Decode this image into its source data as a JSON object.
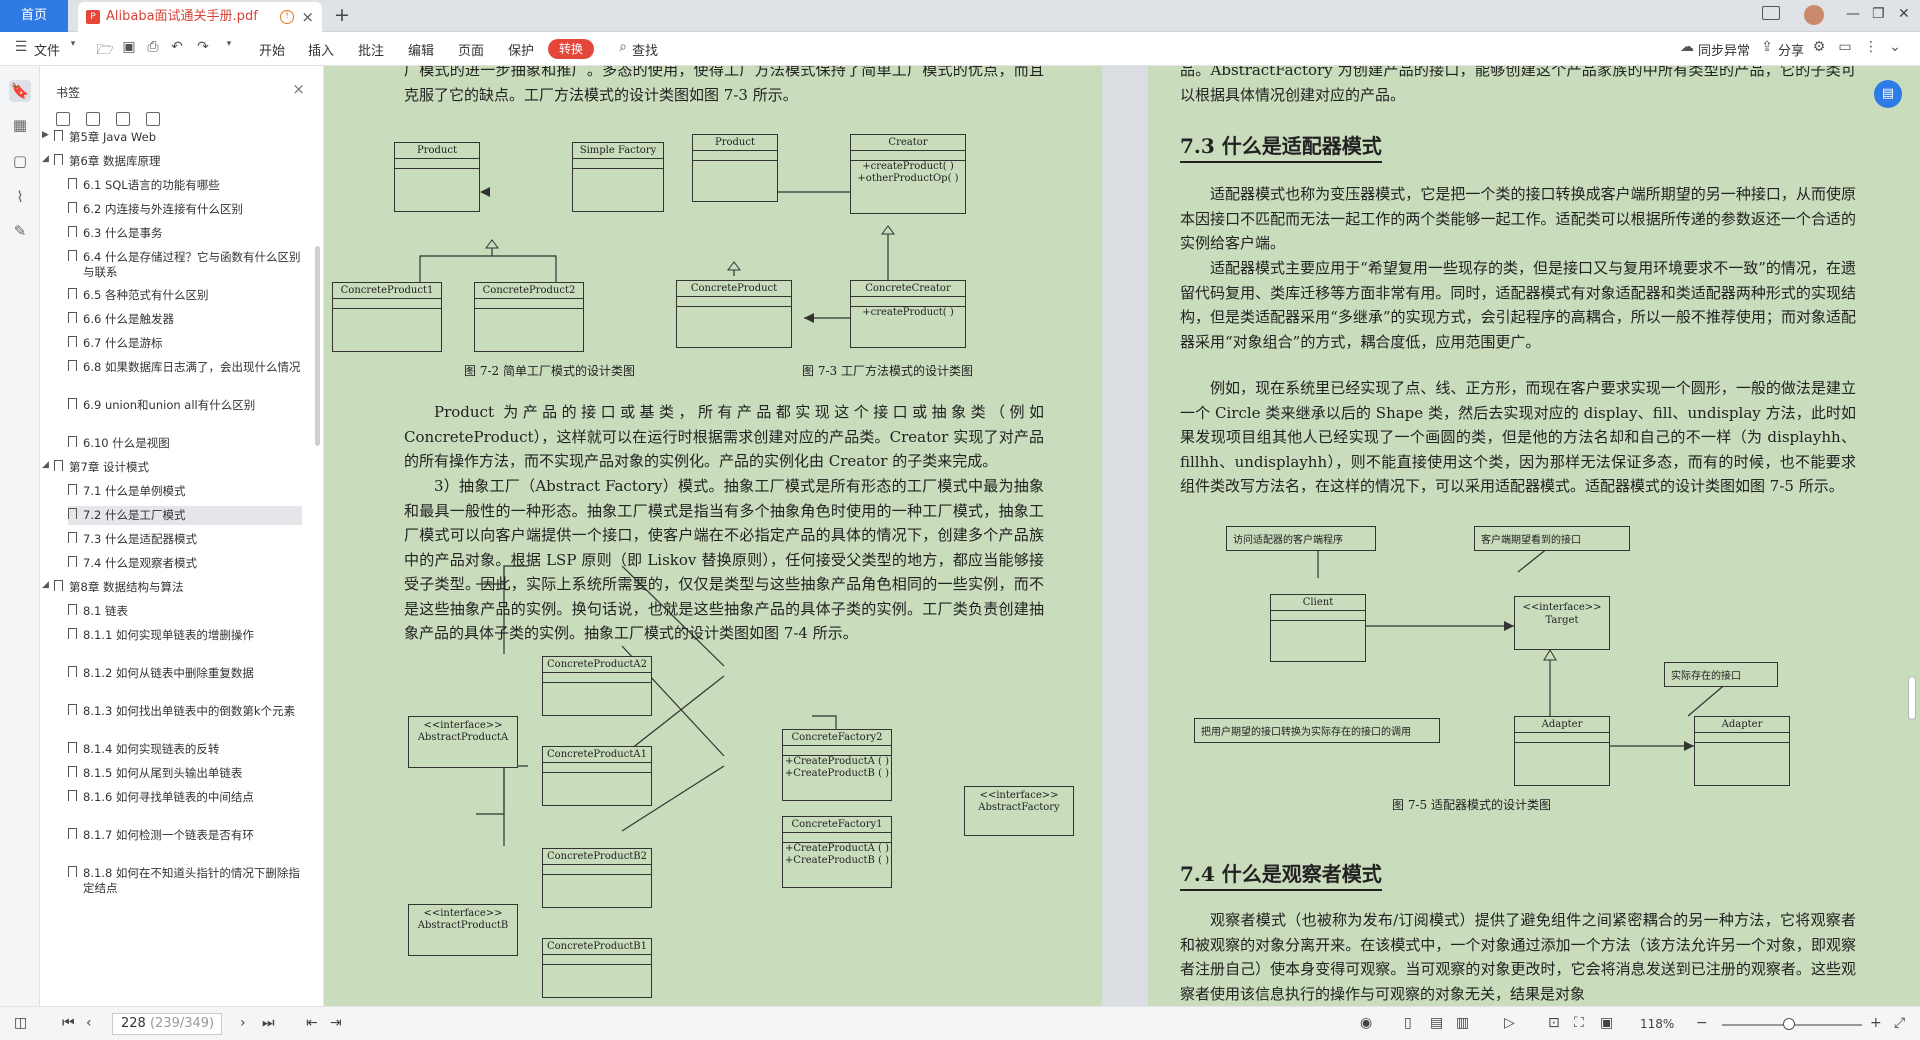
{
  "tabs": {
    "home": "首页",
    "doc_title": "Alibaba面试通关手册.pdf",
    "pdf_badge": "P",
    "warn": "!",
    "close": "×",
    "add": "+"
  },
  "window": {
    "min": "—",
    "restore": "❐",
    "close": "✕"
  },
  "toolbar": {
    "file": "文件",
    "start": "开始",
    "insert": "插入",
    "annotate": "批注",
    "edit": "编辑",
    "page": "页面",
    "protect": "保护",
    "convert": "转换",
    "find": "查找",
    "sync": "同步异常",
    "share": "分享"
  },
  "sidebar": {
    "title": "书签",
    "items": [
      {
        "label": "第5章 Java Web",
        "level": 0,
        "arrow": "▶"
      },
      {
        "label": "第6章 数据库原理",
        "level": 0,
        "arrow": "◢"
      },
      {
        "label": "6.1  SQL语言的功能有哪些",
        "level": 1
      },
      {
        "label": "6.2  内连接与外连接有什么区别",
        "level": 1
      },
      {
        "label": "6.3  什么是事务",
        "level": 1
      },
      {
        "label": "6.4  什么是存储过程？它与函数有什么区别与联系",
        "level": 1
      },
      {
        "label": "6.5  各种范式有什么区别",
        "level": 1
      },
      {
        "label": "6.6  什么是触发器",
        "level": 1
      },
      {
        "label": "6.7  什么是游标",
        "level": 1
      },
      {
        "label": "6.8  如果数据库日志满了，会出现什么情况",
        "level": 1
      },
      {
        "label": "6.9  union和union all有什么区别",
        "level": 1
      },
      {
        "label": "6.10  什么是视图",
        "level": 1
      },
      {
        "label": "第7章 设计模式",
        "level": 0,
        "arrow": "◢"
      },
      {
        "label": "7.1  什么是单例模式",
        "level": 1
      },
      {
        "label": "7.2  什么是工厂模式",
        "level": 1,
        "selected": true
      },
      {
        "label": "7.3  什么是适配器模式",
        "level": 1
      },
      {
        "label": "7.4  什么是观察者模式",
        "level": 1
      },
      {
        "label": "第8章 数据结构与算法",
        "level": 0,
        "arrow": "◢"
      },
      {
        "label": "8.1  链表",
        "level": 1
      },
      {
        "label": "8.1.1  如何实现单链表的增删操作",
        "level": 1
      },
      {
        "label": "8.1.2  如何从链表中删除重复数据",
        "level": 1
      },
      {
        "label": "8.1.3  如何找出单链表中的倒数第k个元素",
        "level": 1
      },
      {
        "label": "8.1.4  如何实现链表的反转",
        "level": 1
      },
      {
        "label": "8.1.5  如何从尾到头输出单链表",
        "level": 1
      },
      {
        "label": "8.1.6  如何寻找单链表的中间结点",
        "level": 1
      },
      {
        "label": "8.1.7  如何检测一个链表是否有环",
        "level": 1
      },
      {
        "label": "8.1.8  如何在不知道头指针的情况下删除指定结点",
        "level": 1
      }
    ]
  },
  "left_page": {
    "p1": "厂模式的进一步抽象和推广。多态的使用，使得工厂方法模式保持了简单工厂模式的优点，而且克服了它的缺点。工厂方法模式的设计类图如图 7-3 所示。",
    "cap72": "图 7-2   简单工厂模式的设计类图",
    "cap73": "图 7-3   工厂方法模式的设计类图",
    "p2": "Product 为产品的接口或基类，所有产品都实现这个接口或抽象类（例如 ConcreteProduct），这样就可以在运行时根据需求创建对应的产品类。Creator 实现了对产品的所有操作方法，而不实现产品对象的实例化。产品的实例化由 Creator 的子类来完成。",
    "p3": "3）抽象工厂（Abstract Factory）模式。抽象工厂模式是所有形态的工厂模式中最为抽象和最具一般性的一种形态。抽象工厂模式是指当有多个抽象角色时使用的一种工厂模式，抽象工厂模式可以向客户端提供一个接口，使客户端在不必指定产品的具体的情况下，创建多个产品族中的产品对象。根据 LSP 原则（即 Liskov 替换原则），任何接受父类型的地方，都应当能够接受子类型。因此，实际上系统所需要的，仅仅是类型与这些抽象产品角色相同的一些实例，而不是这些抽象产品的实例。换句话说，也就是这些抽象产品的具体子类的实例。工厂类负责创建抽象产品的具体子类的实例。抽象工厂模式的设计类图如图 7-4 所示。",
    "uml": {
      "product": "Product",
      "simple_factory": "Simple Factory",
      "cp1": "ConcreteProduct1",
      "cp2": "ConcreteProduct2",
      "product2": "Product",
      "creator": "Creator",
      "creator_ops": "+createProduct( )\n+otherProductOp( )",
      "concrete_product": "ConcreteProduct",
      "concrete_creator": "ConcreteCreator",
      "cc_ops": "+createProduct( )",
      "cpa2": "ConcreteProductA2",
      "apa": "<<interface>>\nAbstractProductA",
      "cpa1": "ConcreteProductA1",
      "cf2": "ConcreteFactory2",
      "cf_ops": "+CreateProductA ( )\n+CreateProductB ( )",
      "af": "<<interface>>\nAbstractFactory",
      "cf1": "ConcreteFactory1",
      "cpb2": "ConcreteProductB2",
      "apb": "<<interface>>\nAbstractProductB",
      "cpb1": "ConcreteProductB1"
    }
  },
  "right_page": {
    "p0": "品。AbstractFactory 为创建产品的接口，能够创建这个产品家族的中所有类型的产品，它的子类可以根据具体情况创建对应的产品。",
    "h73": "7.3   什么是适配器模式",
    "p1": "适配器模式也称为变压器模式，它是把一个类的接口转换成客户端所期望的另一种接口，从而使原本因接口不匹配而无法一起工作的两个类能够一起工作。适配类可以根据所传递的参数返还一个合适的实例给客户端。",
    "p2": "适配器模式主要应用于“希望复用一些现存的类，但是接口又与复用环境要求不一致”的情况，在遗留代码复用、类库迁移等方面非常有用。同时，适配器模式有对象适配器和类适配器两种形式的实现结构，但是类适配器采用“多继承”的实现方式，会引起程序的高耦合，所以一般不推荐使用；而对象适配器采用“对象组合”的方式，耦合度低，应用范围更广。",
    "p3": "例如，现在系统里已经实现了点、线、正方形，而现在客户要求实现一个圆形，一般的做法是建立一个 Circle 类来继承以后的 Shape 类，然后去实现对应的 display、fill、undisplay 方法，此时如果发现项目组其他人已经实现了一个画圆的类，但是他的方法名却和自己的不一样（为 displayhh、fillhh、undisplayhh），则不能直接使用这个类，因为那样无法保证多态，而有的时候，也不能要求组件类改写方法名，在这样的情况下，可以采用适配器模式。适配器模式的设计类图如图 7-5 所示。",
    "uml": {
      "note_client": "访问适配器的客户端程序",
      "note_target": "客户端期望看到的接口",
      "client": "Client",
      "target": "<<interface>>\nTarget",
      "note_adaptee": "实际存在的接口",
      "note_adapter": "把用户期望的接口转换为实际存在的接口的调用",
      "adapter": "Adapter",
      "adaptee": "Adapter"
    },
    "cap75": "图 7-5   适配器模式的设计类图",
    "h74": "7.4   什么是观察者模式",
    "p4": "观察者模式（也被称为发布/订阅模式）提供了避免组件之间紧密耦合的另一种方法，它将观察者和被观察的对象分离开来。在该模式中，一个对象通过添加一个方法（该方法允许另一个对象，即观察者注册自己）使本身变得可观察。当可观察的对象更改时，它会将消息发送到已注册的观察者。这些观察者使用该信息执行的操作与可观察的对象无关，结果是对象"
  },
  "status": {
    "page_num": "228",
    "page_total": "(239/349)",
    "zoom": "118%"
  }
}
